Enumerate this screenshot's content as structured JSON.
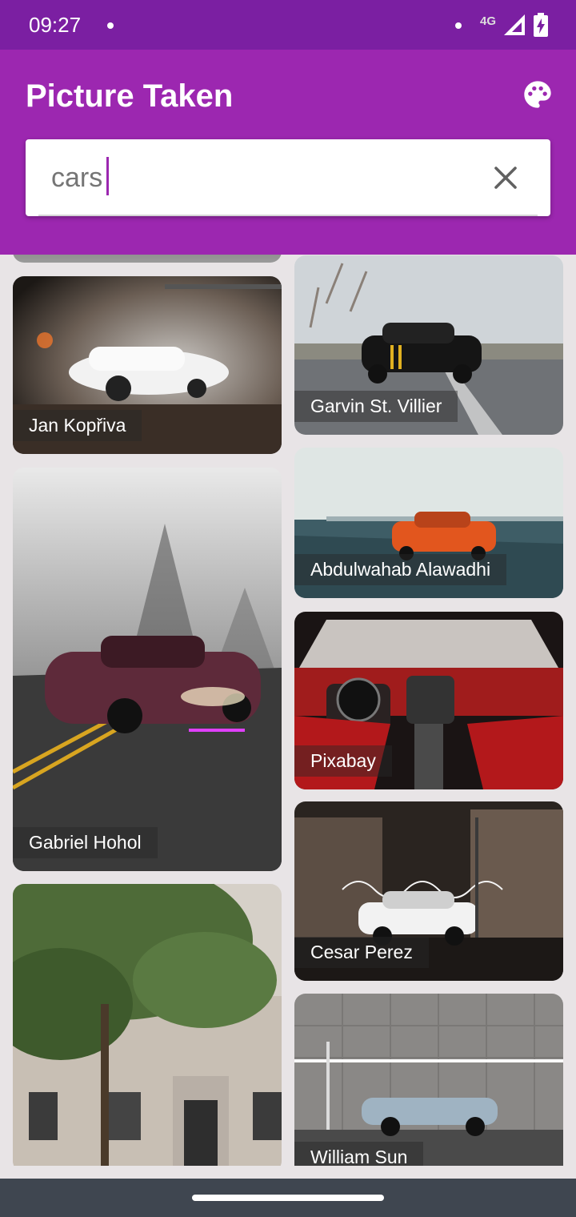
{
  "status_bar": {
    "time": "09:27",
    "network": "4G"
  },
  "app": {
    "title": "Picture Taken"
  },
  "search": {
    "value": "cars"
  },
  "photos": [
    {
      "author": "Jan Kopřiva"
    },
    {
      "author": "Garvin St. Villier"
    },
    {
      "author": "Abdulwahab Alawadhi"
    },
    {
      "author": "Gabriel Hohol"
    },
    {
      "author": "Pixabay"
    },
    {
      "author": "Cesar Perez"
    },
    {
      "author": "William Sun"
    }
  ],
  "colors": {
    "status_bar": "#7b1fa2",
    "app_bar": "#9c27b0",
    "accent": "#9c27b0",
    "nav_bar": "#3f4650"
  }
}
